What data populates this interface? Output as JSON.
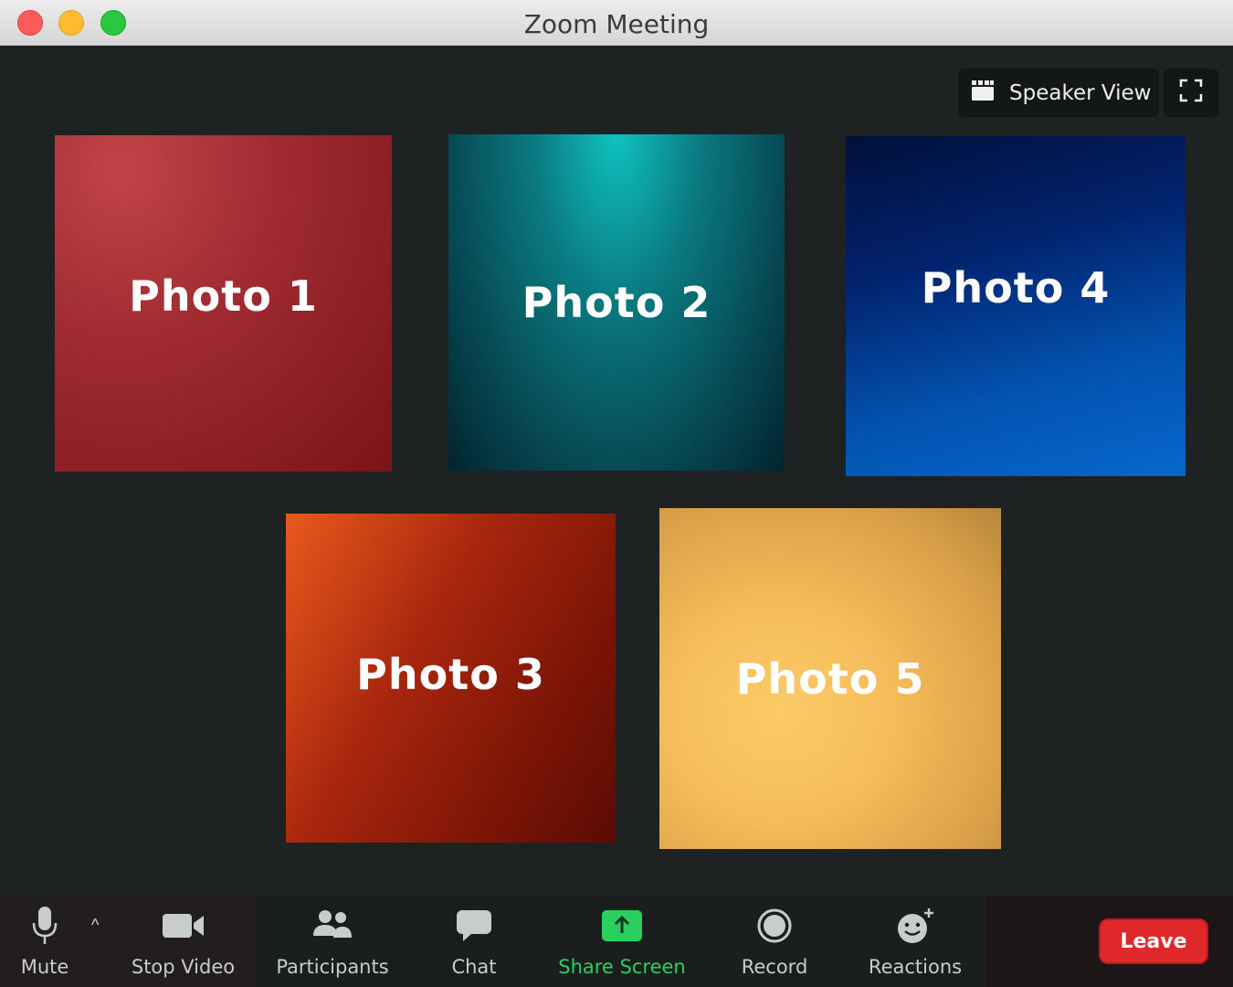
{
  "window": {
    "title": "Zoom Meeting"
  },
  "view_controls": {
    "speaker_view_label": "Speaker View"
  },
  "tiles": [
    {
      "label": "Photo 1",
      "color": "#a02c32"
    },
    {
      "label": "Photo 2",
      "color": "#0a7a80"
    },
    {
      "label": "Photo 4",
      "color": "#02236e"
    },
    {
      "label": "Photo 3",
      "color": "#a8260e"
    },
    {
      "label": "Photo 5",
      "color": "#f5bd5a"
    }
  ],
  "toolbar": {
    "mute_label": "Mute",
    "stop_video_label": "Stop Video",
    "participants_label": "Participants",
    "chat_label": "Chat",
    "share_screen_label": "Share Screen",
    "record_label": "Record",
    "reactions_label": "Reactions",
    "leave_label": "Leave",
    "accent_green": "#2ad05f",
    "leave_color": "#e0282b"
  },
  "icons": [
    "microphone-icon",
    "caret-up-icon",
    "video-camera-icon",
    "participants-icon",
    "chat-bubble-icon",
    "share-screen-icon",
    "record-icon",
    "reactions-icon",
    "speaker-view-icon",
    "fullscreen-icon"
  ]
}
